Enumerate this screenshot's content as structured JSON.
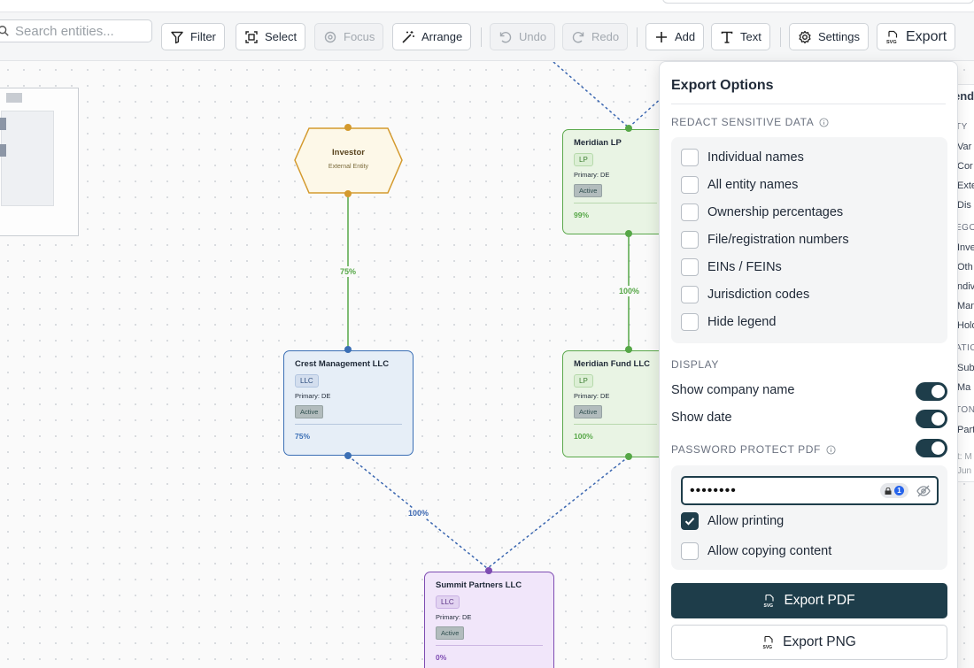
{
  "search": {
    "placeholder": "Search entities..."
  },
  "toolbar": {
    "filter": "Filter",
    "select": "Select",
    "focus": "Focus",
    "arrange": "Arrange",
    "undo": "Undo",
    "redo": "Redo",
    "add": "Add",
    "text": "Text",
    "settings": "Settings",
    "export": "Export"
  },
  "nodes": {
    "investor": {
      "title": "Investor",
      "subtitle": "External Entity"
    },
    "crest": {
      "title": "Crest Management LLC",
      "badge": "LLC",
      "primary": "Primary: DE",
      "status": "Active",
      "pct": "75%"
    },
    "meridian_lp": {
      "title": "Meridian LP",
      "badge": "LP",
      "primary": "Primary: DE",
      "status": "Active",
      "pct": "99%"
    },
    "meridian_fund": {
      "title": "Meridian Fund LLC",
      "badge": "LP",
      "primary": "Primary: DE",
      "status": "Active",
      "pct": "100%"
    },
    "summit": {
      "title": "Summit Partners LLC",
      "badge": "LLC",
      "primary": "Primary: DE",
      "status": "Active",
      "pct": "0%"
    }
  },
  "edges": {
    "investor_crest": "75%",
    "meridianlp_fund": "100%",
    "crest_summit": "100%"
  },
  "legend": {
    "title": "end",
    "heading_entity": "TY",
    "entity_items": [
      "Var",
      "Cor",
      "Exte",
      "Dis"
    ],
    "heading_category": "EGO",
    "category_items": [
      "Inve",
      "Oth",
      "ndiv",
      "Man",
      "Hold"
    ],
    "heading_relation": "ATIC",
    "relation_items": [
      "Sub",
      "Ma"
    ],
    "heading_custom": "TON",
    "custom_items": [
      "Part"
    ],
    "footer_1": "t: M",
    "footer_2": "Jun"
  },
  "panel": {
    "title": "Export Options",
    "redact_heading": "REDACT SENSITIVE DATA",
    "redact_items": [
      {
        "label": "Individual names",
        "checked": false
      },
      {
        "label": "All entity names",
        "checked": false
      },
      {
        "label": "Ownership percentages",
        "checked": false
      },
      {
        "label": "File/registration numbers",
        "checked": false
      },
      {
        "label": "EINs / FEINs",
        "checked": false
      },
      {
        "label": "Jurisdiction codes",
        "checked": false
      },
      {
        "label": "Hide legend",
        "checked": false
      }
    ],
    "display_heading": "DISPLAY",
    "show_company_name": "Show company name",
    "show_company_name_on": true,
    "show_date": "Show date",
    "show_date_on": true,
    "password_heading": "PASSWORD PROTECT PDF",
    "password_on": true,
    "password_value": "••••••••",
    "allow_printing": "Allow printing",
    "allow_printing_checked": true,
    "allow_copying": "Allow copying content",
    "allow_copying_checked": false,
    "export_pdf": "Export PDF",
    "export_png": "Export PNG"
  },
  "colors": {
    "accent": "#1e3d4a",
    "investor_border": "#d49a2e",
    "investor_fill": "#fdf8e8",
    "crest_border": "#3b6fb5",
    "crest_fill": "#e6eef7",
    "meridian_border": "#5aa84b",
    "meridian_fill": "#e9f4e4",
    "summit_border": "#7e4cb2",
    "summit_fill": "#f1e6fa"
  }
}
